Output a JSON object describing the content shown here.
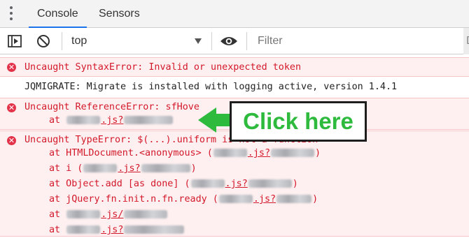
{
  "tabs": {
    "console": "Console",
    "sensors": "Sensors"
  },
  "toolbar": {
    "context": "top",
    "filter_placeholder": "Filter",
    "levels_partial": "D"
  },
  "messages": [
    {
      "level": "error",
      "text": "Uncaught SyntaxError: Invalid or unexpected token"
    },
    {
      "level": "info",
      "text": "JQMIGRATE: Migrate is installed with logging active, version 1.4.1"
    },
    {
      "level": "error",
      "text": "Uncaught ReferenceError: sfHove",
      "stack": [
        {
          "prefix": "at ",
          "file": ".js?"
        }
      ]
    },
    {
      "level": "error",
      "text": "Uncaught TypeError: $(...).uniform is not a function",
      "stack": [
        {
          "prefix": "at HTMLDocument.<anonymous> (",
          "file": ".js?",
          "suffix": ")"
        },
        {
          "prefix": "at i (",
          "file": ".js?",
          "suffix": ")"
        },
        {
          "prefix": "at Object.add [as done] (",
          "file": ".js?",
          "suffix": ")"
        },
        {
          "prefix": "at jQuery.fn.init.n.fn.ready (",
          "file": ".js?",
          "suffix": ")"
        },
        {
          "prefix": "at ",
          "file": ".js/"
        },
        {
          "prefix": "at ",
          "file": ".js?"
        }
      ]
    }
  ],
  "callout": {
    "label": "Click here",
    "color": "#2dba3d"
  },
  "colors": {
    "error_text": "#d3182a",
    "error_bg": "#fef0f0",
    "tab_accent": "#1a73e8"
  }
}
